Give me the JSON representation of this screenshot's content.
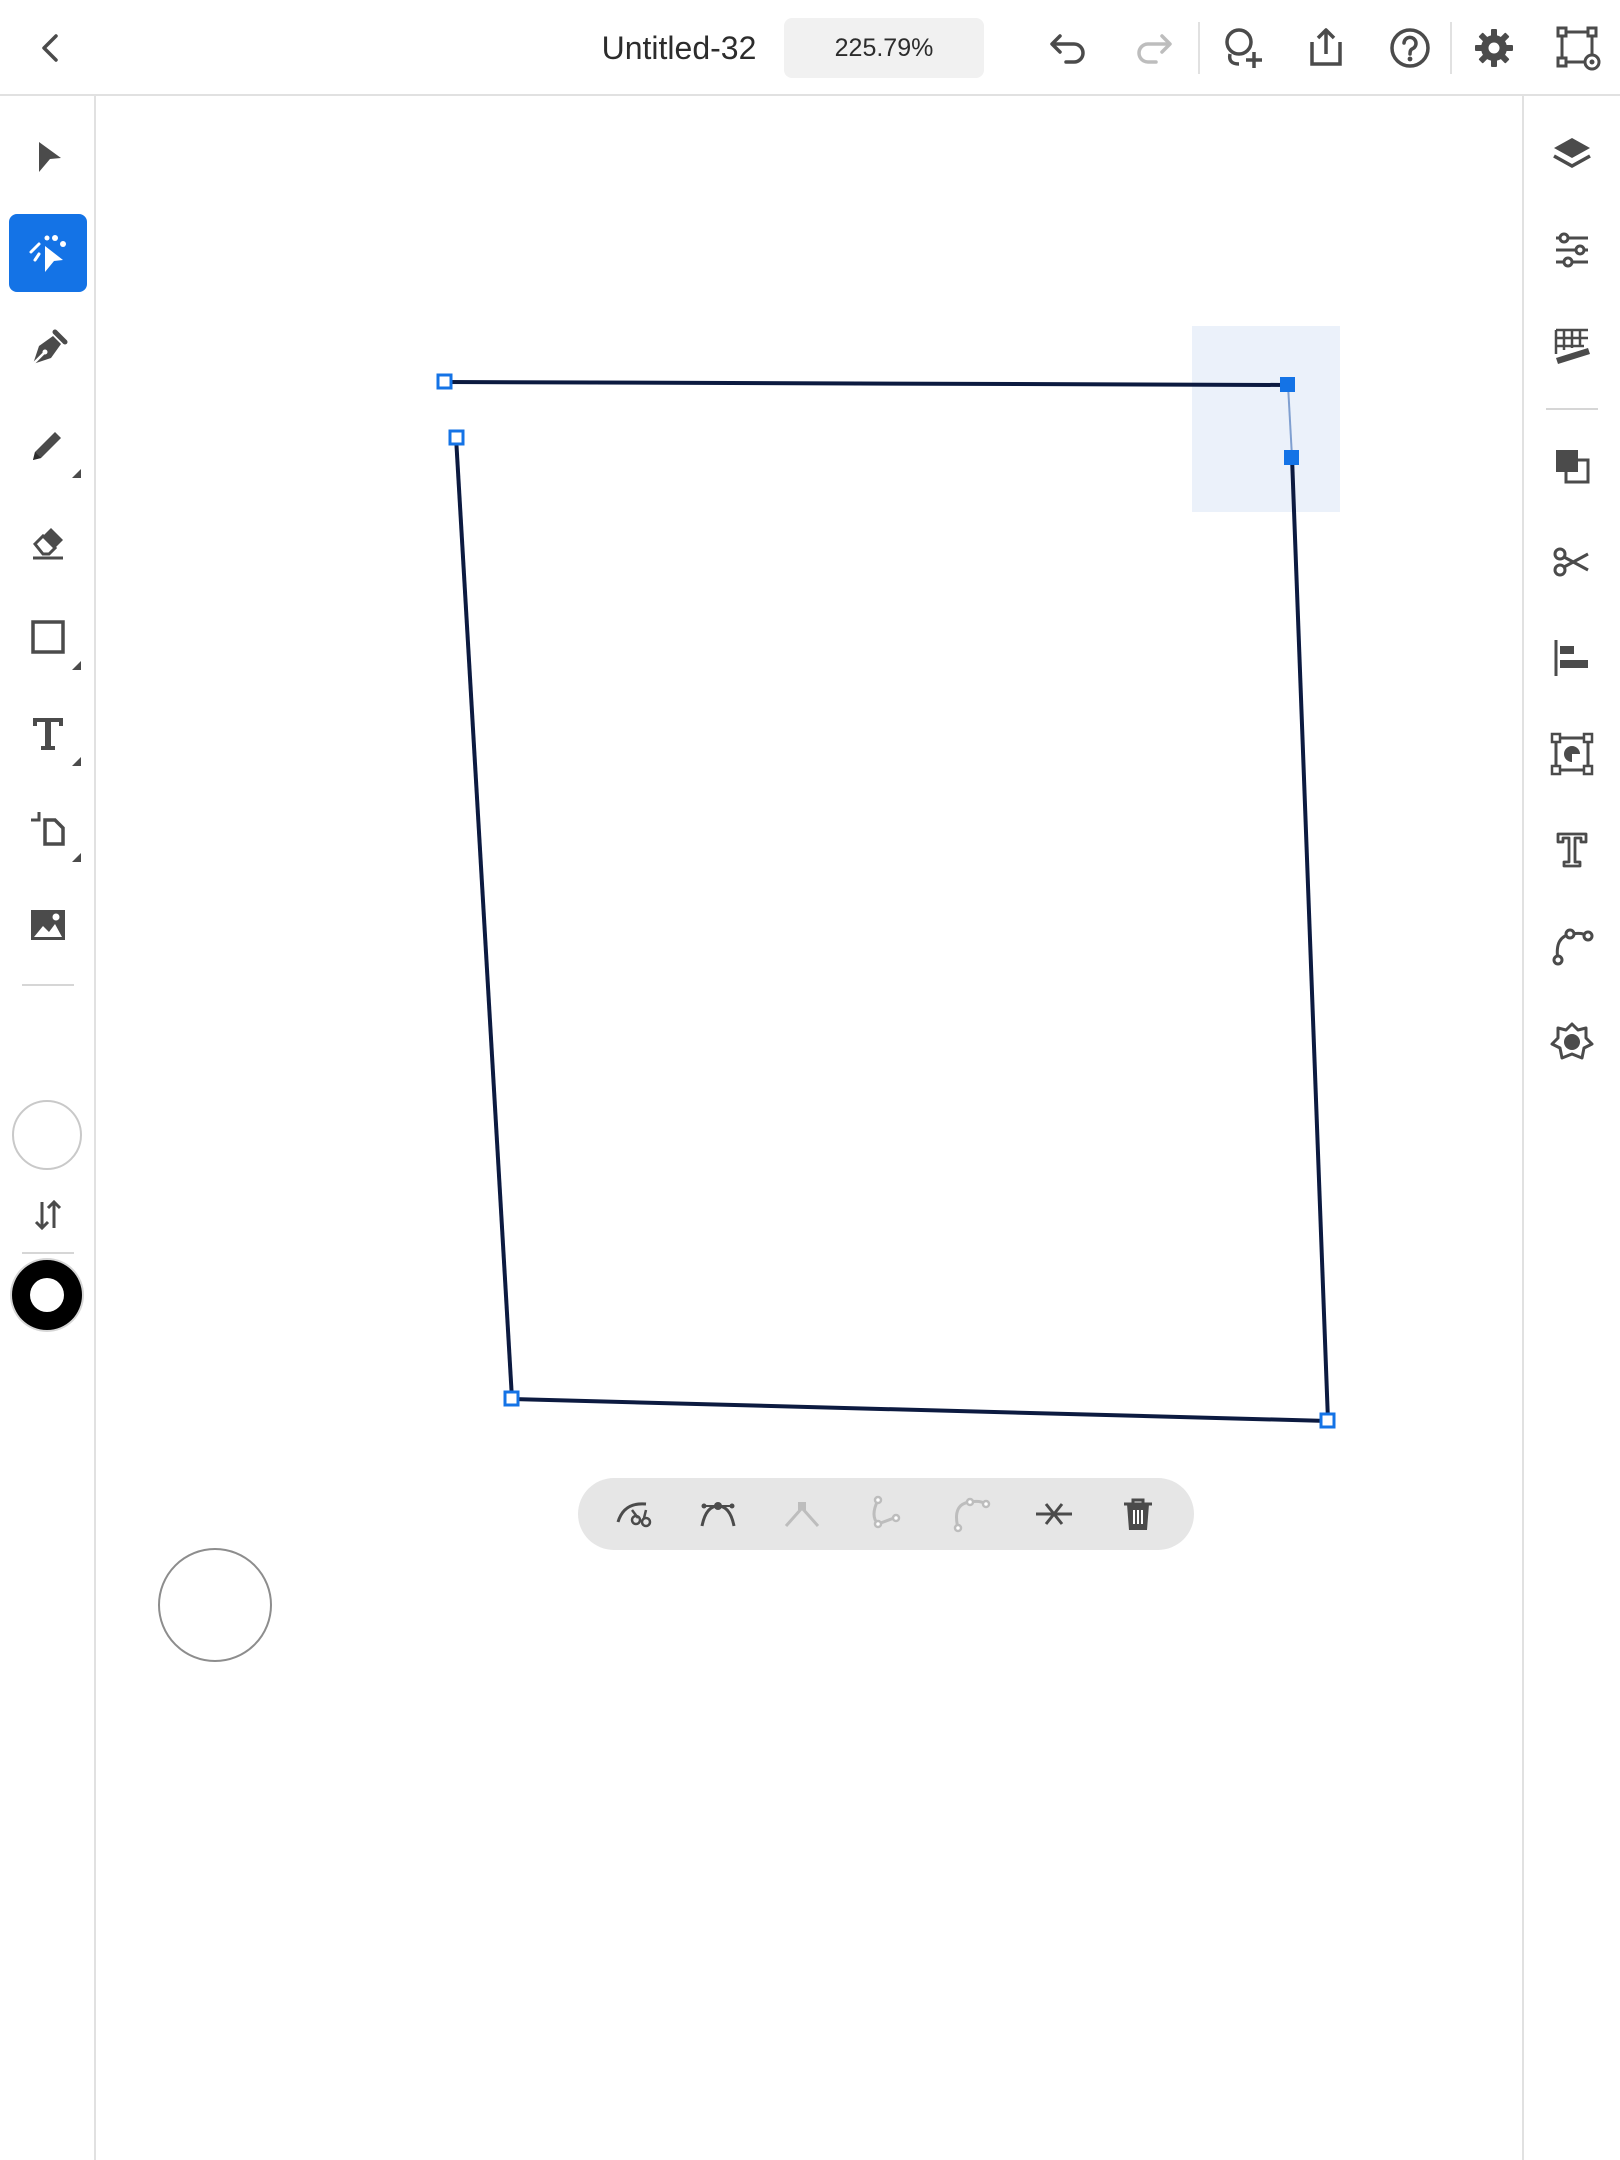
{
  "header": {
    "back_icon": "chevron-left-icon",
    "document_title": "Untitled-32",
    "zoom_level": "225.79%",
    "actions": [
      "undo-icon",
      "redo-icon",
      "invite-icon",
      "share-icon",
      "help-icon",
      "settings-icon",
      "path-view-icon"
    ]
  },
  "left_tools": {
    "items": [
      "selection-tool",
      "direct-selection-tool",
      "pen-tool",
      "pencil-tool",
      "eraser-tool",
      "rectangle-tool",
      "type-tool",
      "transform-tool",
      "place-image-tool"
    ],
    "active": "direct-selection-tool",
    "fill_color": "#ffffff",
    "stroke_color": "#000000"
  },
  "right_panel": {
    "items": [
      "layers-icon",
      "properties-icon",
      "grid-ruler-icon",
      "pathfinder-icon",
      "scissors-icon",
      "align-icon",
      "repeat-icon",
      "type-options-icon",
      "path-options-icon",
      "symbols-icon"
    ]
  },
  "context_toolbar": {
    "items": [
      "cut-path-icon",
      "smooth-anchor-icon",
      "corner-anchor-icon",
      "convert-anchor-icon",
      "path-curve-icon",
      "remove-anchor-icon",
      "delete-icon"
    ]
  },
  "colors": {
    "accent": "#1473e6",
    "path_stroke": "#0c1a40",
    "anchor": "#1473e6"
  }
}
